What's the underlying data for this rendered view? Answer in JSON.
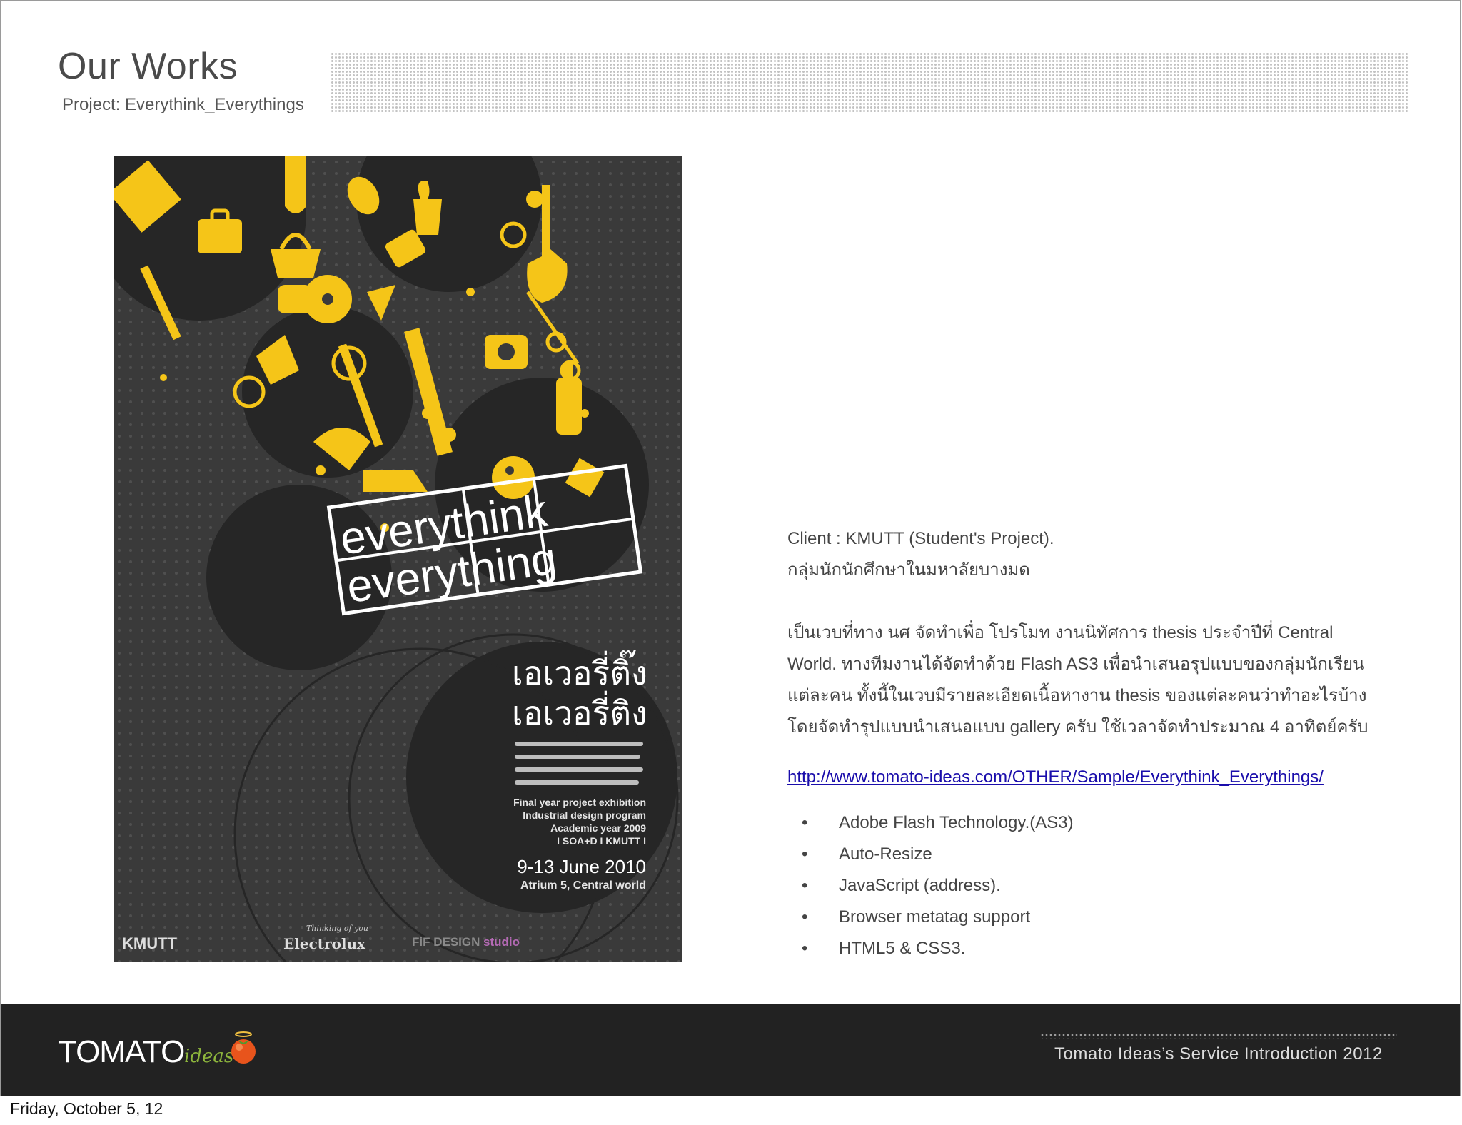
{
  "header": {
    "title": "Our Works",
    "subtitle": "Project:  Everythink_Everythings"
  },
  "poster": {
    "logo_top": "everythink",
    "logo_bottom": "everything",
    "thai_line1": "เอเวอรี่ติ๊ง",
    "thai_line2": "เอเวอรี่ติง",
    "event_lines": [
      "Final year project exhibition",
      "Industrial design program",
      "Academic year 2009",
      "I SOA+D I KMUTT I"
    ],
    "dates": "9-13 June 2010",
    "venue": "Atrium 5, Central world",
    "sponsor_1": "KMUTT",
    "sponsor_2": "Electrolux",
    "sponsor_2_tagline": "Thinking of you",
    "sponsor_3": "FiF DESIGN",
    "sponsor_3_suffix": "studio",
    "accent_color": "#f5c518",
    "background_color": "#3a3a3a"
  },
  "info": {
    "client": "Client : KMUTT (Student's Project).",
    "client_thai": "กลุ่มนักนักศึกษาในมหาลัยบางมด",
    "description": [
      "เป็นเวบที่ทาง นศ จัดทำเพื่อ โปรโมท งานนิทัศการ thesis ประจำปีที่ Central",
      "World. ทางทีมงานได้จัดทำด้วย Flash AS3 เพื่อนำเสนอรุปแบบของกลุ่มนักเรียน",
      "แต่ละคน ทั้งนี้ในเวบมีรายละเอียดเนื้อหางาน thesis ของแต่ละคนว่าทำอะไรบ้าง",
      "โดยจัดทำรุปแบบนำเสนอแบบ gallery ครับ ใช้เวลาจัดทำประมาณ 4 อาทิตย์ครับ"
    ],
    "link": "http://www.tomato-ideas.com/OTHER/Sample/Everythink_Everythings/",
    "bullet_symbol": "•",
    "features": [
      "Adobe Flash Technology.(AS3)",
      "Auto-Resize",
      "JavaScript (address).",
      "Browser metatag support",
      "HTML5 & CSS3."
    ]
  },
  "footer": {
    "logo_main": "TOMATO",
    "logo_sub": "ideas",
    "tagline": "Tomato Ideas’s Service Introduction 2012"
  },
  "date_label": "Friday, October 5, 12"
}
